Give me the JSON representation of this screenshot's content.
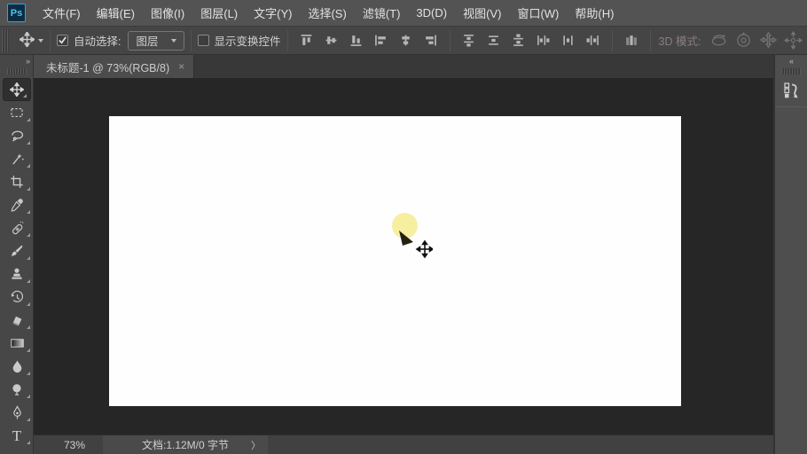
{
  "app": {
    "logo": "Ps"
  },
  "menubar": {
    "items": [
      {
        "label": "文件(F)"
      },
      {
        "label": "编辑(E)"
      },
      {
        "label": "图像(I)"
      },
      {
        "label": "图层(L)"
      },
      {
        "label": "文字(Y)"
      },
      {
        "label": "选择(S)"
      },
      {
        "label": "滤镜(T)"
      },
      {
        "label": "3D(D)"
      },
      {
        "label": "视图(V)"
      },
      {
        "label": "窗口(W)"
      },
      {
        "label": "帮助(H)"
      }
    ]
  },
  "options_bar": {
    "active_tool_icon": "move-icon",
    "auto_select": {
      "label": "自动选择:",
      "checked": true
    },
    "layer_select": {
      "value": "图层"
    },
    "show_transform": {
      "label": "显示变换控件",
      "checked": false
    },
    "align_icons": [
      "align-top-edges",
      "align-vertical-centers",
      "align-bottom-edges",
      "align-left-edges",
      "align-horizontal-centers",
      "align-right-edges"
    ],
    "distribute_icons": [
      "distribute-top-edges",
      "distribute-vertical-centers",
      "distribute-bottom-edges",
      "distribute-left-edges",
      "distribute-horizontal-centers",
      "distribute-right-edges"
    ],
    "auto_align_icon": "auto-align-layers",
    "mode_3d_label": "3D 模式:",
    "mode_3d_icons": [
      "3d-rotate",
      "3d-roll",
      "3d-pan",
      "3d-slide",
      "3d-scale"
    ]
  },
  "tab": {
    "title": "未标题-1 @ 73%(RGB/8)",
    "close_glyph": "×"
  },
  "tooldock": {
    "collapse_glyph": "»",
    "tools": [
      "move",
      "rectangular-marquee",
      "lasso",
      "quick-selection",
      "crop",
      "eyedropper",
      "spot-healing-brush",
      "brush",
      "clone-stamp",
      "history-brush",
      "eraser",
      "gradient",
      "blur",
      "dodge",
      "pen",
      "type"
    ],
    "selected_tool": "move",
    "type_glyph": "T"
  },
  "rightdock": {
    "collapse_glyph": "«",
    "panel_icon": "history-panel-icon"
  },
  "status_bar": {
    "zoom": "73%",
    "doc_info": "文档:1.12M/0 字节",
    "chevron": "〉"
  },
  "colors": {
    "accent_logo": "#4cc3f0",
    "click_highlight": "#f6efa0",
    "canvas_white": "#fefefe",
    "pasteboard": "#262626",
    "chrome": "#474747"
  }
}
